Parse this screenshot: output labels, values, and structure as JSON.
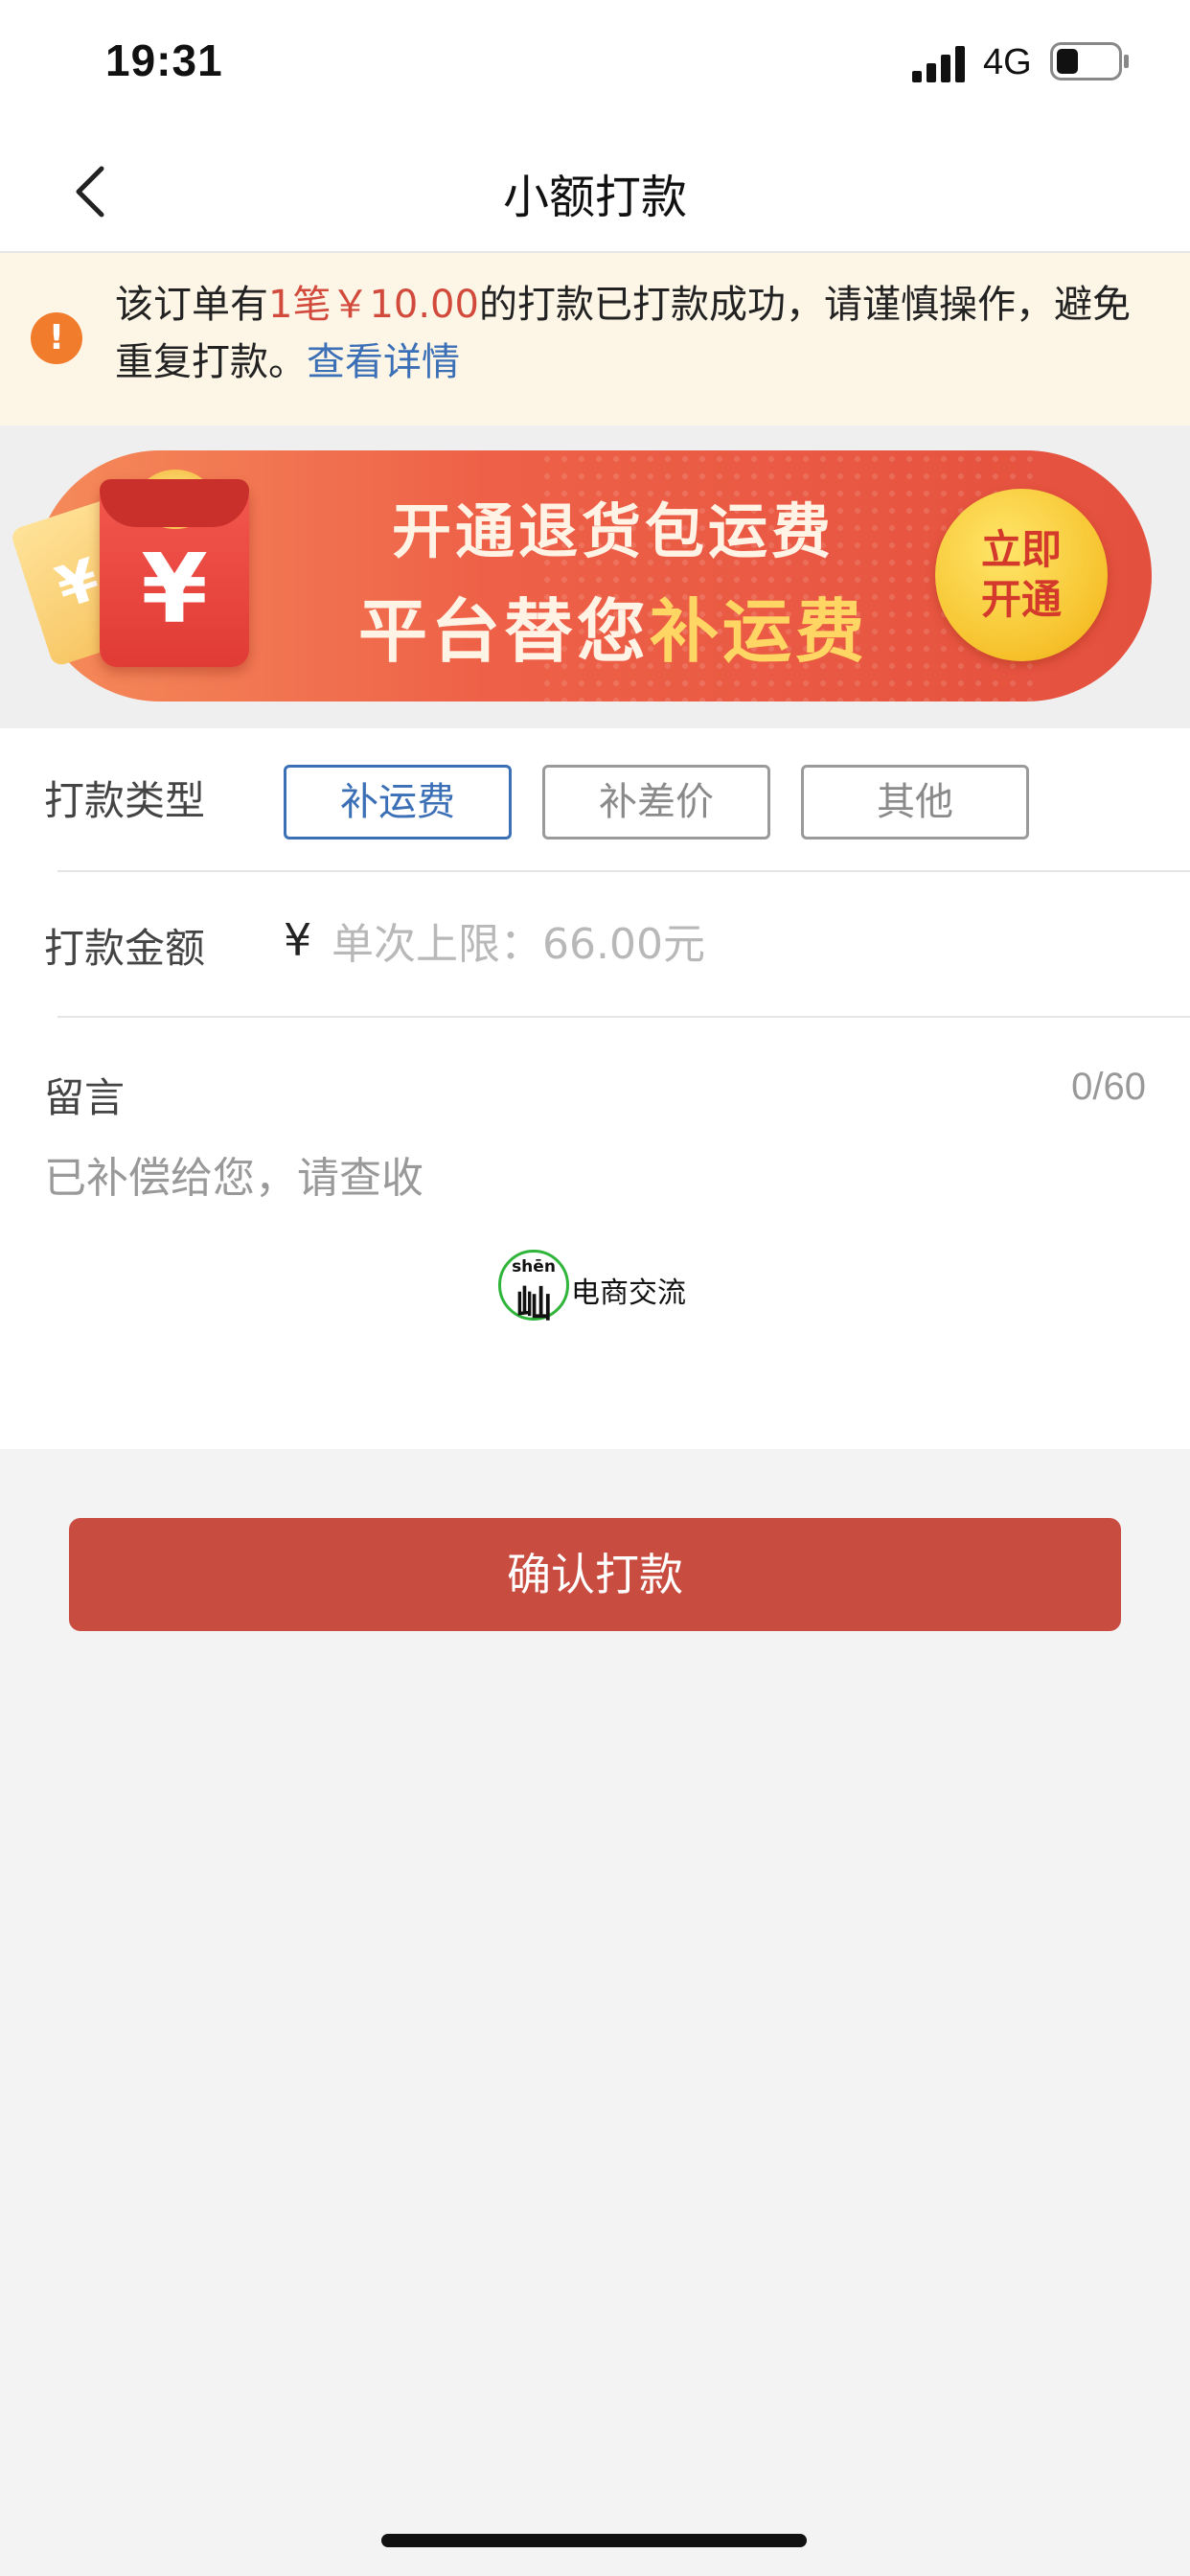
{
  "status_bar": {
    "time": "19:31",
    "network": "4G",
    "icons": [
      "signal-icon",
      "battery-icon"
    ]
  },
  "nav": {
    "title": "小额打款",
    "back_icon": "back-chevron-icon"
  },
  "notice": {
    "icon": "exclamation-icon",
    "text_before": "该订单有",
    "highlight": "1笔￥10.00",
    "text_after": "的打款已打款成功，请谨慎操作，避免重复打款。",
    "link": "查看详情"
  },
  "banner": {
    "line1": "开通退货包运费",
    "line2_prefix": "平台替您",
    "line2_highlight": "补运费",
    "button_line1": "立即",
    "button_line2": "开通",
    "redpack_symbol": "¥",
    "coupon_symbol": "¥"
  },
  "form": {
    "type": {
      "label": "打款类型",
      "options": [
        "补运费",
        "补差价",
        "其他"
      ],
      "selected": "补运费"
    },
    "amount": {
      "label": "打款金额",
      "currency": "¥",
      "placeholder": "单次上限：66.00元"
    },
    "message": {
      "label": "留言",
      "counter": "0/60",
      "placeholder": "已补偿给您，请查收"
    }
  },
  "watermark": {
    "logo_pinyin": "shēn",
    "logo_char": "屾",
    "text": "电商交流"
  },
  "confirm_button": "确认打款",
  "colors": {
    "accent_red": "#c84c3f",
    "link_blue": "#3b6fb6",
    "notice_bg": "#fdf6e7",
    "warning_orange": "#f17c2b"
  }
}
